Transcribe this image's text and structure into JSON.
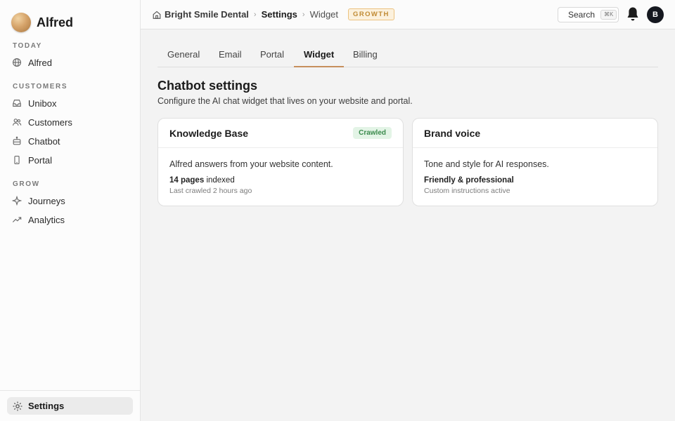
{
  "app": {
    "name": "Alfred"
  },
  "sidebar": {
    "sections": [
      {
        "label": "TODAY"
      },
      {
        "label": "CUSTOMERS"
      },
      {
        "label": "GROW"
      }
    ],
    "items": [
      {
        "label": "Alfred",
        "icon": "globe-icon"
      },
      {
        "label": "Unibox",
        "icon": "inbox-icon"
      },
      {
        "label": "Customers",
        "icon": "users-icon"
      },
      {
        "label": "Chatbot",
        "icon": "bot-icon"
      },
      {
        "label": "Portal",
        "icon": "phone-icon"
      },
      {
        "label": "Journeys",
        "icon": "sparkle-icon"
      },
      {
        "label": "Analytics",
        "icon": "trend-icon"
      }
    ],
    "settings": {
      "label": "Settings",
      "icon": "gear-icon"
    }
  },
  "topbar": {
    "breadcrumb": [
      "Bright Smile Dental",
      "Settings",
      "Widget"
    ],
    "plan_badge": "GROWTH",
    "search_label": "Search",
    "search_shortcut": "⌘K",
    "avatar_initial": "B"
  },
  "tabs": [
    "General",
    "Email",
    "Portal",
    "Widget",
    "Billing"
  ],
  "active_tab": "Widget",
  "page": {
    "title": "Chatbot settings",
    "subtitle": "Configure the AI chat widget that lives on your website and portal."
  },
  "cards": [
    {
      "title": "Knowledge Base",
      "badge": "Crawled",
      "description": "Alfred answers from your website content.",
      "stat_bold": "14 pages",
      "stat_rest": "indexed",
      "meta": "Last crawled 2 hours ago"
    },
    {
      "title": "Brand voice",
      "description": "Tone and style for AI responses.",
      "stat_bold": "Friendly & professional",
      "meta": "Custom instructions active"
    }
  ],
  "colors": {
    "accent_tab": "#c68f5d",
    "badge_growth": "#c08a33",
    "badge_crawled": "#3a8a4c"
  }
}
